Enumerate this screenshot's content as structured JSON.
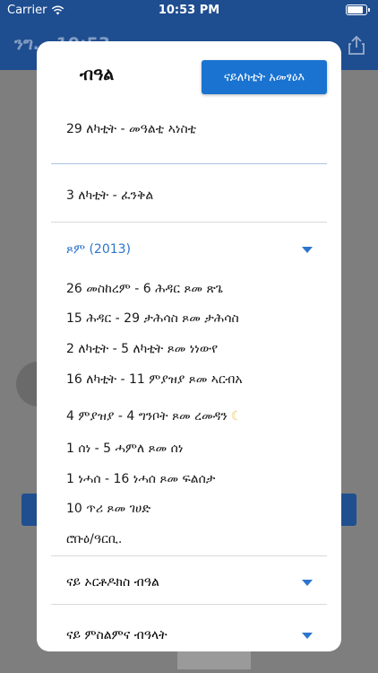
{
  "status_bar": {
    "carrier": "Carrier",
    "time": "10:53 PM"
  },
  "background_app": {
    "title": "ንግ… 10:53 …"
  },
  "modal": {
    "title": "ብዓል",
    "add_button": "ናይለካቲት አመፃዕእ",
    "items_top": [
      "29 ለካቲት - መዓልቲ ኣነስቲ",
      "3 ለካቲት - ፈንቅል"
    ],
    "fasting_section": {
      "label": "ጾም (2013)",
      "items": [
        "26 መስከረም - 6 ሕዳር ጾመ ጽጌ",
        "15 ሕዳር - 29 ታሕሳስ ጾመ ታሕሳስ",
        "2 ለካቲት - 5 ለካቲት ጾመ ነነውየ",
        "16 ለካቲት - 11 ምያዝያ ጾመ ኣርብአ",
        "4 ምያዝያ - 4 ግንቦት ጾመ ረመዳን",
        "1 ሰነ - 5 ሓምለ ጾመ ሰነ",
        "1 ነሓሰ - 16 ነሓሰ ጾመ ፍልሰታ",
        "10 ጥሪ ጾመ ገሀድ",
        "ሮቡዕ/ዓርቢ."
      ]
    },
    "orthodox_section": {
      "label": "ናይ ኦርቶዶክስ ብዓል"
    },
    "muslim_section": {
      "label": "ናይ ምስልምና ብዓላት"
    }
  },
  "colors": {
    "app_blue": "#1e4d90",
    "button_blue": "#1a73d1",
    "accent_blue": "#2d75cc"
  }
}
